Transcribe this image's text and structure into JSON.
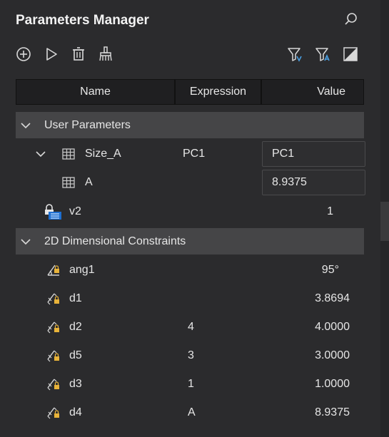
{
  "panel": {
    "title": "Parameters Manager"
  },
  "toolbar": {
    "left_icons": [
      "add-icon",
      "play-icon",
      "delete-icon",
      "purge-icon"
    ],
    "right_icons": [
      "filter-icon",
      "filter-expression-icon",
      "toggle-icon"
    ]
  },
  "columns": {
    "name": "Name",
    "expression": "Expression",
    "value": "Value"
  },
  "groups": [
    {
      "label": "User Parameters",
      "rows": [
        {
          "name": "Size_A",
          "expression": "PC1",
          "value": "PC1"
        },
        {
          "name": "A",
          "expression": "",
          "value": "8.9375"
        },
        {
          "name": "v2",
          "expression": "",
          "value": "1"
        }
      ]
    },
    {
      "label": "2D Dimensional Constraints",
      "rows": [
        {
          "name": "ang1",
          "expression": "",
          "value": "95°"
        },
        {
          "name": "d1",
          "expression": "",
          "value": "3.8694"
        },
        {
          "name": "d2",
          "expression": "4",
          "value": "4.0000"
        },
        {
          "name": "d5",
          "expression": "3",
          "value": "3.0000"
        },
        {
          "name": "d3",
          "expression": "1",
          "value": "1.0000"
        },
        {
          "name": "d4",
          "expression": "A",
          "value": "8.9375"
        }
      ]
    }
  ],
  "colors": {
    "background": "#2b2b2d",
    "group_header": "#454547",
    "accent_blue": "#4a9ee0",
    "lock_yellow": "#e8b33a"
  }
}
